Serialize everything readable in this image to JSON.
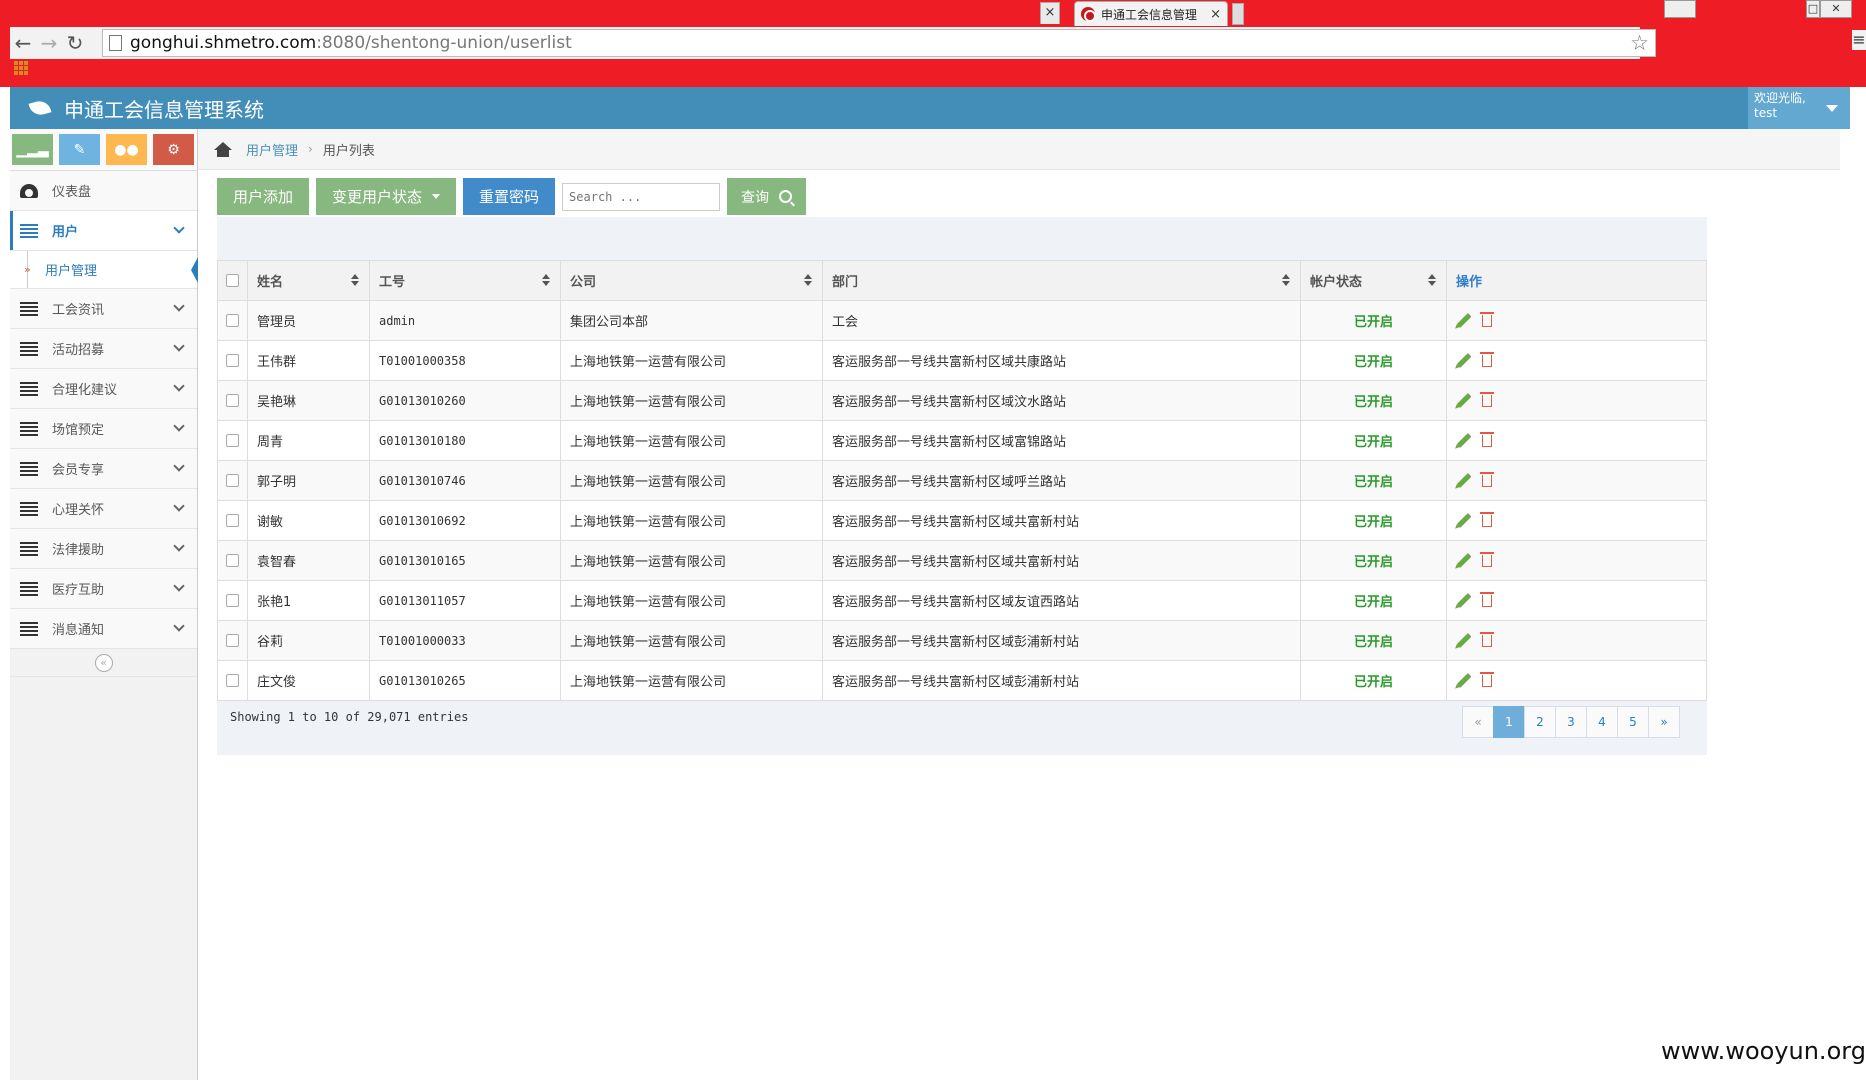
{
  "browser": {
    "active_tab_title": "申通工会信息管理",
    "url_host": "gonghui.shmetro.com",
    "url_rest": ":8080/shentong-union/userlist"
  },
  "navbar": {
    "brand": "申通工会信息管理系统",
    "welcome": "欢迎光临,",
    "username": "test"
  },
  "sidebar": {
    "items": [
      {
        "label": "仪表盘",
        "icon": "dashboard-icon"
      },
      {
        "label": "用户",
        "icon": "list-icon"
      },
      {
        "label": "工会资讯",
        "icon": "list-icon"
      },
      {
        "label": "活动招募",
        "icon": "list-icon"
      },
      {
        "label": "合理化建议",
        "icon": "list-icon"
      },
      {
        "label": "场馆预定",
        "icon": "list-icon"
      },
      {
        "label": "会员专享",
        "icon": "list-icon"
      },
      {
        "label": "心理关怀",
        "icon": "list-icon"
      },
      {
        "label": "法律援助",
        "icon": "list-icon"
      },
      {
        "label": "医疗互助",
        "icon": "list-icon"
      },
      {
        "label": "消息通知",
        "icon": "list-icon"
      }
    ],
    "sub_item": "用户管理",
    "shortcut_colors": [
      "#87b87f",
      "#6fb3e0",
      "#ffb752",
      "#d15b47"
    ]
  },
  "breadcrumb": {
    "parent": "用户管理",
    "current": "用户列表"
  },
  "actions": {
    "add_user": "用户添加",
    "change_status": "变更用户状态",
    "reset_password": "重置密码",
    "search_placeholder": "Search ...",
    "query": "查询"
  },
  "table": {
    "headers": {
      "name": "姓名",
      "job_no": "工号",
      "company": "公司",
      "department": "部门",
      "status": "帐户状态",
      "operation": "操作"
    },
    "rows": [
      {
        "name": "管理员",
        "job_no": "admin",
        "company": "集团公司本部",
        "department": "工会",
        "status": "已开启"
      },
      {
        "name": "王伟群",
        "job_no": "T01001000358",
        "company": "上海地铁第一运营有限公司",
        "department": "客运服务部一号线共富新村区域共康路站",
        "status": "已开启"
      },
      {
        "name": "吴艳琳",
        "job_no": "G01013010260",
        "company": "上海地铁第一运营有限公司",
        "department": "客运服务部一号线共富新村区域汶水路站",
        "status": "已开启"
      },
      {
        "name": "周青",
        "job_no": "G01013010180",
        "company": "上海地铁第一运营有限公司",
        "department": "客运服务部一号线共富新村区域富锦路站",
        "status": "已开启"
      },
      {
        "name": "郭子明",
        "job_no": "G01013010746",
        "company": "上海地铁第一运营有限公司",
        "department": "客运服务部一号线共富新村区域呼兰路站",
        "status": "已开启"
      },
      {
        "name": "谢敏",
        "job_no": "G01013010692",
        "company": "上海地铁第一运营有限公司",
        "department": "客运服务部一号线共富新村区域共富新村站",
        "status": "已开启"
      },
      {
        "name": "袁智春",
        "job_no": "G01013010165",
        "company": "上海地铁第一运营有限公司",
        "department": "客运服务部一号线共富新村区域共富新村站",
        "status": "已开启"
      },
      {
        "name": "张艳1",
        "job_no": "G01013011057",
        "company": "上海地铁第一运营有限公司",
        "department": "客运服务部一号线共富新村区域友谊西路站",
        "status": "已开启"
      },
      {
        "name": "谷莉",
        "job_no": "T01001000033",
        "company": "上海地铁第一运营有限公司",
        "department": "客运服务部一号线共富新村区域彭浦新村站",
        "status": "已开启"
      },
      {
        "name": "庄文俊",
        "job_no": "G01013010265",
        "company": "上海地铁第一运营有限公司",
        "department": "客运服务部一号线共富新村区域彭浦新村站",
        "status": "已开启"
      }
    ]
  },
  "footer": {
    "info": "Showing 1 to 10 of 29,071 entries",
    "pages": [
      "«",
      "1",
      "2",
      "3",
      "4",
      "5",
      "»"
    ]
  },
  "watermark": "www.wooyun.org",
  "colors": {
    "navbar": "#438eb9",
    "active": "#2b7dbc",
    "status_on": "#2a9a2a"
  }
}
